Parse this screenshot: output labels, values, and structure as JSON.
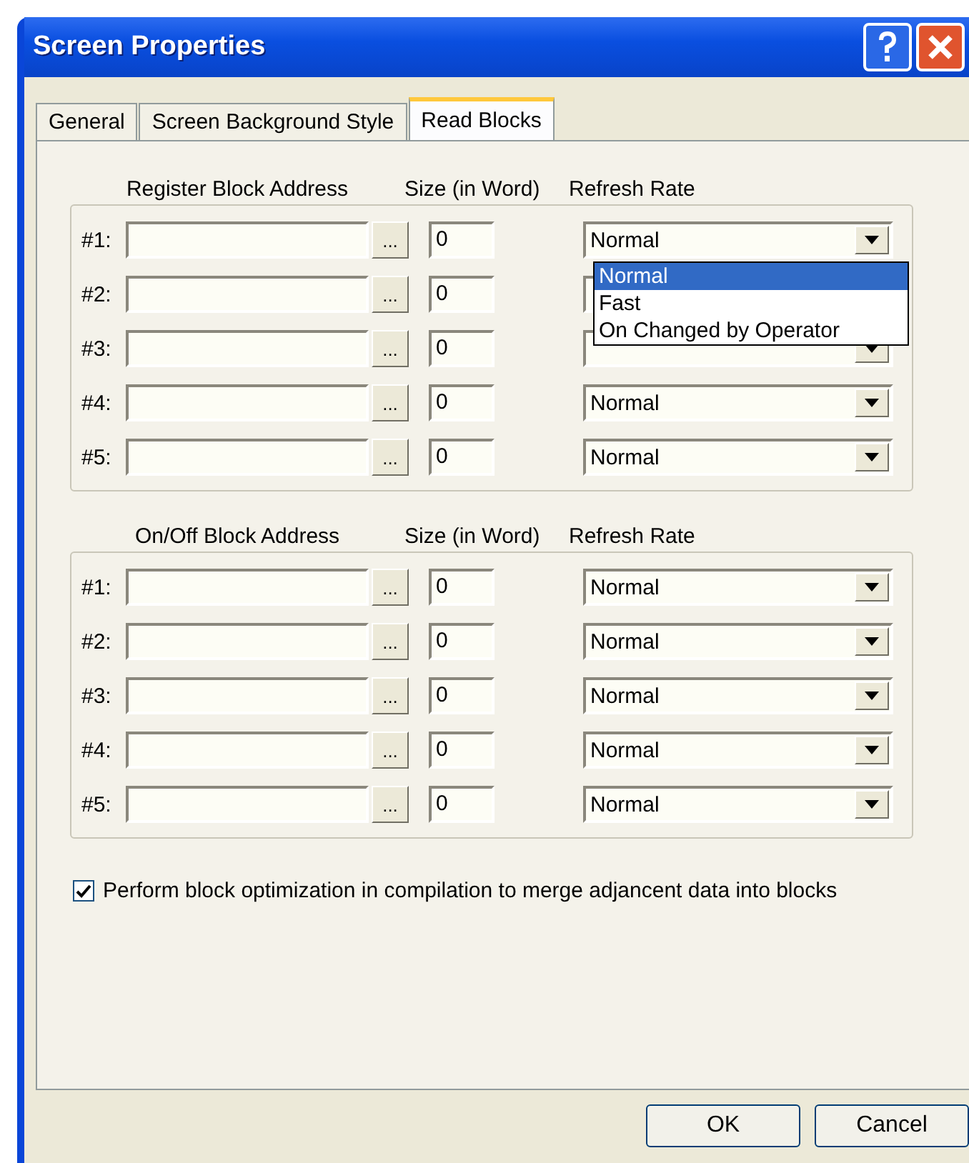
{
  "window": {
    "title": "Screen Properties"
  },
  "tabs": [
    {
      "label": "General",
      "selected": false
    },
    {
      "label": "Screen Background Style",
      "selected": false
    },
    {
      "label": "Read Blocks",
      "selected": true
    }
  ],
  "groups": [
    {
      "address_heading": "Register Block Address",
      "size_heading": "Size (in Word)",
      "rate_heading": "Refresh Rate",
      "browse": "...",
      "rows": [
        {
          "label": "#1:",
          "size": "0",
          "refresh": "Normal",
          "options": [
            {
              "label": "Normal",
              "selected": true
            },
            {
              "label": "Fast",
              "selected": false
            },
            {
              "label": "On Changed by Operator",
              "selected": false
            }
          ]
        },
        {
          "label": "#2:",
          "size": "0"
        },
        {
          "label": "#3:",
          "size": "0"
        },
        {
          "label": "#4:",
          "size": "0",
          "refresh": "Normal"
        },
        {
          "label": "#5:",
          "size": "0",
          "refresh": "Normal"
        }
      ]
    },
    {
      "address_heading": "On/Off Block Address",
      "size_heading": "Size (in Word)",
      "rate_heading": "Refresh Rate",
      "browse": "...",
      "rows": [
        {
          "label": "#1:",
          "size": "0",
          "refresh": "Normal"
        },
        {
          "label": "#2:",
          "size": "0",
          "refresh": "Normal"
        },
        {
          "label": "#3:",
          "size": "0",
          "refresh": "Normal"
        },
        {
          "label": "#4:",
          "size": "0",
          "refresh": "Normal"
        },
        {
          "label": "#5:",
          "size": "0",
          "refresh": "Normal"
        }
      ]
    }
  ],
  "optimize": {
    "label": "Perform block optimization in compilation to merge adjancent data into blocks",
    "checked": true
  },
  "buttons": [
    "OK",
    "Cancel"
  ]
}
